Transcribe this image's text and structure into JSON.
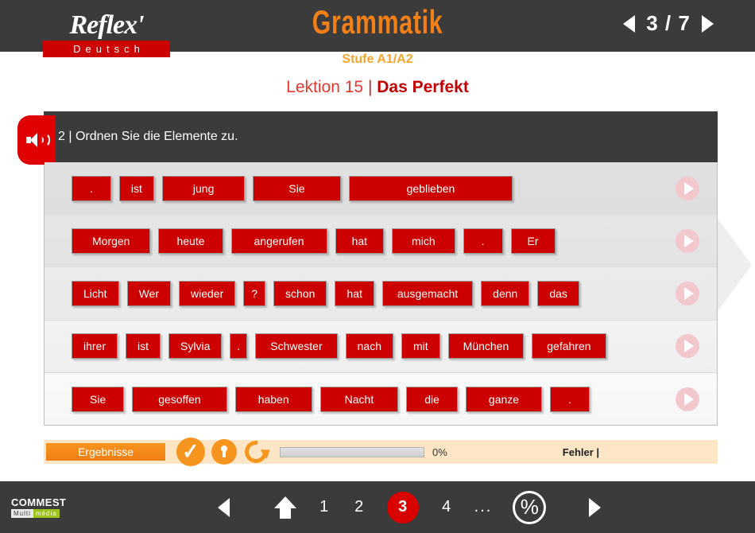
{
  "header": {
    "logo_main": "Reflex'",
    "logo_sub": "Deutsch",
    "title": "Grammatik",
    "pager": {
      "current": "3",
      "total": "7",
      "display": "3 / 7",
      "prev_icon": "triangle-left-icon",
      "next_icon": "triangle-right-icon"
    },
    "level": "Stufe A1/A2",
    "lesson_prefix": "Lektion 15",
    "lesson_separator": "|",
    "lesson_title": "Das Perfekt",
    "colors": {
      "bar": "#3b3b3b",
      "title": "#f28016",
      "level": "#f5a52e",
      "lesson": "#e23a2e",
      "lesson_bold": "#c00000",
      "brand_red": "#cc0000"
    }
  },
  "exercise": {
    "speaker_icon": "speaker-icon",
    "instruction": "2 | Ordnen Sie die Elemente zu.",
    "play_icon": "play-icon",
    "rows": [
      {
        "tiles": [
          ".",
          "ist",
          "jung",
          "Sie",
          "geblieben"
        ]
      },
      {
        "tiles": [
          "Morgen",
          "heute",
          "angerufen",
          "hat",
          "mich",
          ".",
          "Er"
        ]
      },
      {
        "tiles": [
          "Licht",
          "Wer",
          "wieder",
          "?",
          "schon",
          "hat",
          "ausgemacht",
          "denn",
          "das"
        ]
      },
      {
        "tiles": [
          "ihrer",
          "ist",
          "Sylvia",
          ".",
          "Schwester",
          "nach",
          "mit",
          "München",
          "gefahren"
        ]
      },
      {
        "tiles": [
          "Sie",
          "gesoffen",
          "haben",
          "Nacht",
          "die",
          "ganze",
          "."
        ]
      }
    ]
  },
  "results": {
    "label": "Ergebnisse",
    "check_icon": "checkmark-icon",
    "lock_icon": "lock-icon",
    "redo_icon": "redo-icon",
    "percent": "0%",
    "errors_label": "Fehler |",
    "accent": "#f7941e",
    "background": "#fce6c6"
  },
  "footer": {
    "logo_top": "COMMEST",
    "logo_bot_1": "Multi",
    "logo_bot_2": "média",
    "back_icon": "triangle-left-icon",
    "home_icon": "home-icon",
    "pages": [
      "1",
      "2",
      "3",
      "4"
    ],
    "active_page": "3",
    "ellipsis": "...",
    "percent_icon": "%",
    "forward_icon": "triangle-right-icon",
    "active_color": "#d90000"
  }
}
